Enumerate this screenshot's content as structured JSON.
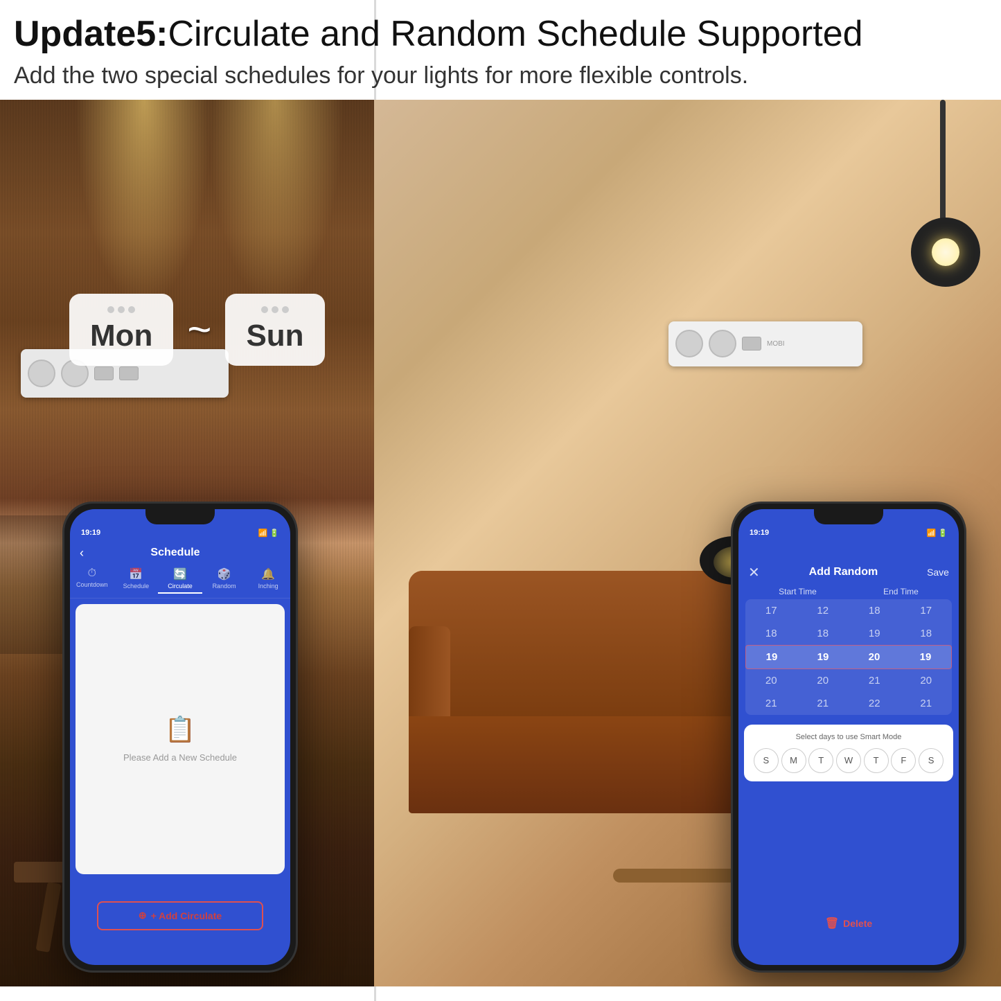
{
  "header": {
    "title_bold": "Update5:",
    "title_regular": "Circulate and Random Schedule Supported",
    "subtitle": "Add the two special schedules for your lights for more flexible controls."
  },
  "left_panel": {
    "mon_badge": "Mon",
    "sun_badge": "Sun",
    "tilde": "~",
    "phone": {
      "status_time": "19:19",
      "app_title": "Schedule",
      "tabs": [
        {
          "label": "Countdown",
          "icon": "⏱"
        },
        {
          "label": "Schedule",
          "icon": "📅"
        },
        {
          "label": "Circulate",
          "icon": "🔄",
          "active": true
        },
        {
          "label": "Random",
          "icon": "🎲"
        },
        {
          "label": "Inching",
          "icon": "🔔"
        }
      ],
      "empty_text": "Please Add a New Schedule",
      "add_button": "+ Add Circulate"
    }
  },
  "right_panel": {
    "phone": {
      "status_time": "19:19",
      "header": {
        "close": "✕",
        "title": "Add Random",
        "save": "Save"
      },
      "time_picker": {
        "columns": [
          "Start Time",
          "End Time"
        ],
        "rows": [
          {
            "values": [
              "17",
              "12",
              "18",
              "17"
            ]
          },
          {
            "values": [
              "18",
              "18",
              "19",
              "18"
            ]
          },
          {
            "values": [
              "19",
              "19",
              "20",
              "19"
            ],
            "selected": true
          },
          {
            "values": [
              "20",
              "20",
              "21",
              "20"
            ]
          },
          {
            "values": [
              "21",
              "21",
              "22",
              "21"
            ]
          }
        ]
      },
      "days_section": {
        "label": "Select days to use Smart Mode",
        "days": [
          "S",
          "M",
          "T",
          "W",
          "T",
          "F",
          "S"
        ]
      },
      "delete_button": "Delete"
    }
  },
  "colors": {
    "accent_blue": "#3050d0",
    "accent_red": "#e05050",
    "white": "#ffffff",
    "dark": "#1a1a1a"
  }
}
